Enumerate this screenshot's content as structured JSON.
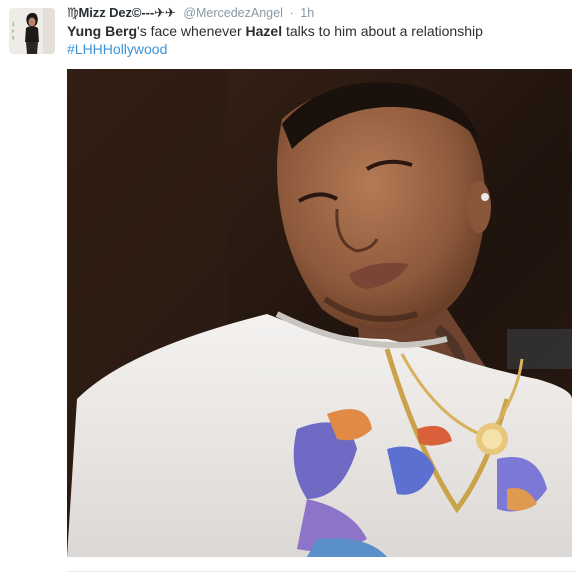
{
  "tweet": {
    "display_name": "♍Mizz Dez©---✈✈",
    "handle": "@MercedezAngel",
    "separator": "·",
    "time": "1h",
    "text_before": "",
    "mention_1": "Yung Berg",
    "text_middle": "'s face whenever ",
    "mention_2": "Hazel",
    "text_after": " talks to him about a relationship",
    "hashtag": "#LHHHollywood"
  },
  "avatar": {
    "icon": "profile-photo-avatar"
  },
  "media": {
    "icon": "tweet-photo"
  },
  "colors": {
    "name": "#292f33",
    "meta": "#8899a6",
    "link": "#3b94d9",
    "divider": "#e1e8ed"
  }
}
